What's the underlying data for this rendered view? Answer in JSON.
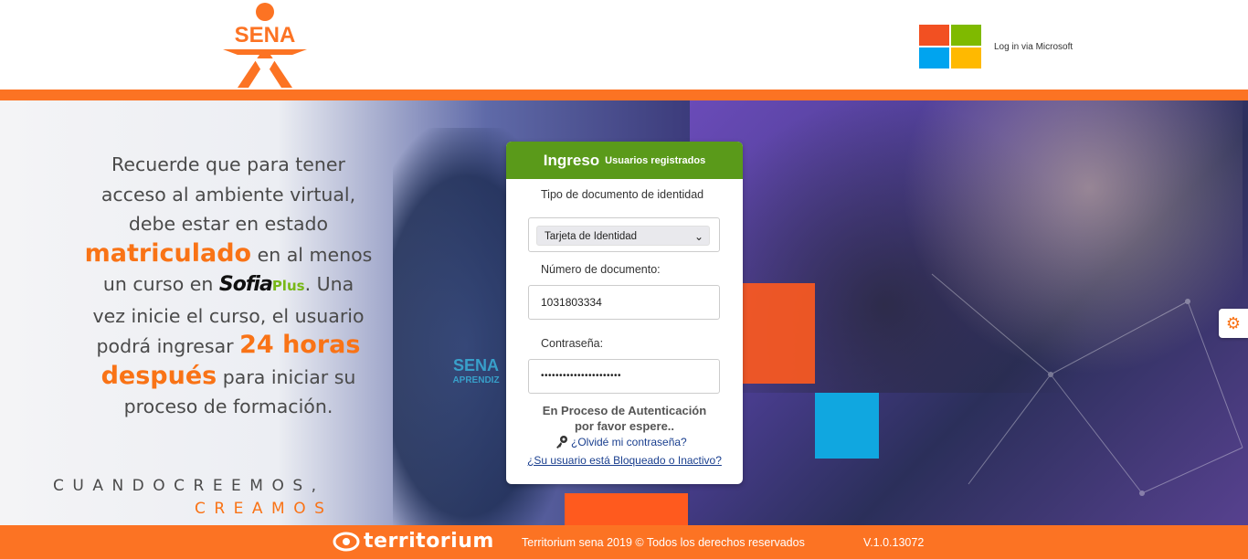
{
  "header": {
    "brand": "SENA",
    "microsoft_login_label": "Log in via Microsoft",
    "colors": {
      "accent": "#fc7323",
      "ms_red": "#f25022",
      "ms_green": "#7fba00",
      "ms_blue": "#00a4ef",
      "ms_yellow": "#ffb900"
    }
  },
  "hero": {
    "msg_l1": "Recuerde que para tener",
    "msg_l2": "acceso al ambiente virtual,",
    "msg_l3": "debe estar en estado",
    "msg_hl1": "matriculado",
    "msg_l4a": " en al menos",
    "msg_l5a": "un curso en ",
    "sofia_a": "Sofia",
    "sofia_b": "Plus",
    "msg_l5b": ". Una",
    "msg_l6": "vez inicie el curso, el usuario",
    "msg_l7a": "podrá ingresar ",
    "msg_hl2": "24 horas",
    "msg_hl3": "después",
    "msg_l8b": " para iniciar su",
    "msg_l9": "proceso de formación.",
    "slogan_line1": "CUANDOCREEMOS,",
    "slogan_line2": "CREAMOS",
    "uniform_text": "SENA",
    "uniform_sub": "APRENDIZ"
  },
  "login": {
    "title": "Ingreso",
    "subtitle": "Usuarios registrados",
    "doc_type_label": "Tipo de documento de identidad",
    "doc_type_value": "Tarjeta de Identidad",
    "doc_number_label": "Número de documento:",
    "doc_number_value": "1031803334",
    "password_label": "Contraseña:",
    "password_value": "••••••••••••••••••••••",
    "auth_line1": "En Proceso de Autenticación",
    "auth_line2": "por favor espere..",
    "forgot_link": "¿Olvidé mi contraseña?",
    "blocked_link": "¿Su usuario está Bloqueado o Inactivo?"
  },
  "footer": {
    "brand": "territorium",
    "copyright": "Territorium sena 2019 © Todos los derechos reservados",
    "version": "V.1.0.13072"
  }
}
